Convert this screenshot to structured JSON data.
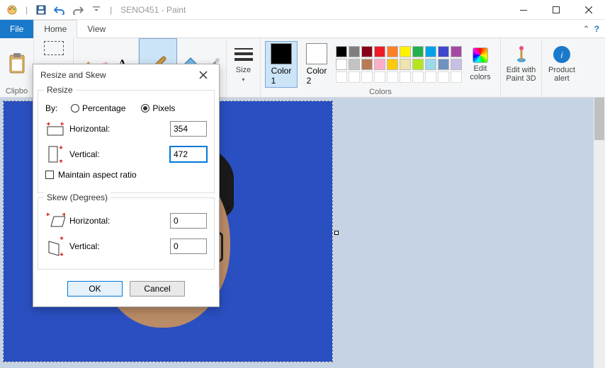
{
  "titlebar": {
    "app_title": "SENO451 - Paint"
  },
  "tabs": {
    "file": "File",
    "home": "Home",
    "view": "View"
  },
  "ribbon": {
    "clipboard_label": "Clipbo",
    "size_label": "Size",
    "color1_label": "Color\n1",
    "color2_label": "Color\n2",
    "edit_colors_label": "Edit\ncolors",
    "paint3d_label": "Edit with\nPaint 3D",
    "alert_label": "Product\nalert",
    "colors_group": "Colors",
    "color1_value": "#000000",
    "color2_value": "#ffffff",
    "palette_row1": [
      "#000000",
      "#7f7f7f",
      "#880015",
      "#ed1c24",
      "#ff7f27",
      "#fff200",
      "#22b14c",
      "#00a2e8",
      "#3f48cc",
      "#a349a4"
    ],
    "palette_row2": [
      "#ffffff",
      "#c3c3c3",
      "#b97a57",
      "#ffaec9",
      "#ffc90e",
      "#efe4b0",
      "#b5e61d",
      "#99d9ea",
      "#7092be",
      "#c8bfe7"
    ]
  },
  "dialog": {
    "title": "Resize and Skew",
    "resize": {
      "legend": "Resize",
      "by_label": "By:",
      "percentage_label": "Percentage",
      "pixels_label": "Pixels",
      "selected": "pixels",
      "horizontal_label": "Horizontal:",
      "vertical_label": "Vertical:",
      "horizontal_value": "354",
      "vertical_value": "472",
      "maintain_label": "Maintain aspect ratio",
      "maintain_checked": false
    },
    "skew": {
      "legend": "Skew (Degrees)",
      "horizontal_label": "Horizontal:",
      "vertical_label": "Vertical:",
      "horizontal_value": "0",
      "vertical_value": "0"
    },
    "ok": "OK",
    "cancel": "Cancel"
  }
}
